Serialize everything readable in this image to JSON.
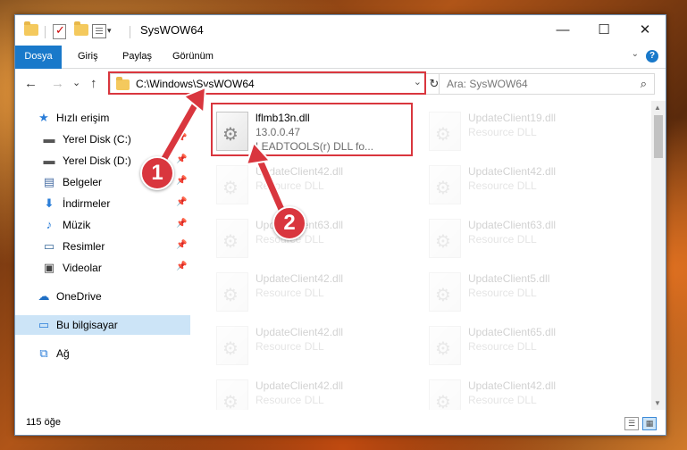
{
  "window": {
    "title": "SysWOW64",
    "controls": {
      "minimize": "—",
      "maximize": "☐",
      "close": "✕"
    }
  },
  "ribbon": {
    "tabs": [
      "Dosya",
      "Giriş",
      "Paylaş",
      "Görünüm"
    ],
    "help": "?"
  },
  "nav": {
    "back": "←",
    "forward": "→",
    "recent": "⌄",
    "up": "↑",
    "address": "C:\\Windows\\SysWOW64",
    "search_placeholder": "Ara: SysWOW64"
  },
  "sidebar": {
    "quick_access": "Hızlı erişim",
    "items": [
      {
        "label": "Yerel Disk (C:)",
        "icon": "drive-icon",
        "pinned": true
      },
      {
        "label": "Yerel Disk (D:)",
        "icon": "drive-icon",
        "pinned": true
      },
      {
        "label": "Belgeler",
        "icon": "documents-icon",
        "pinned": true
      },
      {
        "label": "İndirmeler",
        "icon": "download-icon",
        "pinned": true
      },
      {
        "label": "Müzik",
        "icon": "music-icon",
        "pinned": true
      },
      {
        "label": "Resimler",
        "icon": "pictures-icon",
        "pinned": true
      },
      {
        "label": "Videolar",
        "icon": "videos-icon",
        "pinned": true
      }
    ],
    "onedrive": "OneDrive",
    "this_pc": "Bu bilgisayar",
    "network": "Ağ"
  },
  "files": [
    {
      "name": "lflmb13n.dll",
      "line1": "13.0.0.47",
      "line2": "LEADTOOLS(r) DLL fo...",
      "highlighted": true
    },
    {
      "name": "UpdateClient19.dll",
      "line1": "Resource DLL"
    },
    {
      "name": "UpdateClient42.dll",
      "line1": "Resource DLL"
    },
    {
      "name": "UpdateClient42.dll",
      "line1": "Resource DLL"
    },
    {
      "name": "UpdateClient63.dll",
      "line1": "Resource DLL"
    },
    {
      "name": "UpdateClient63.dll",
      "line1": "Resource DLL"
    },
    {
      "name": "UpdateClient42.dll",
      "line1": "Resource DLL"
    },
    {
      "name": "UpdateClient5.dll",
      "line1": "Resource DLL"
    },
    {
      "name": "UpdateClient42.dll",
      "line1": "Resource DLL"
    },
    {
      "name": "UpdateClient65.dll",
      "line1": "Resource DLL"
    },
    {
      "name": "UpdateClient42.dll",
      "line1": "Resource DLL"
    },
    {
      "name": "UpdateClient42.dll",
      "line1": "Resource DLL"
    }
  ],
  "status": {
    "count": "115 öğe"
  },
  "annotations": {
    "step1": "1",
    "step2": "2",
    "color": "#d9363e"
  }
}
